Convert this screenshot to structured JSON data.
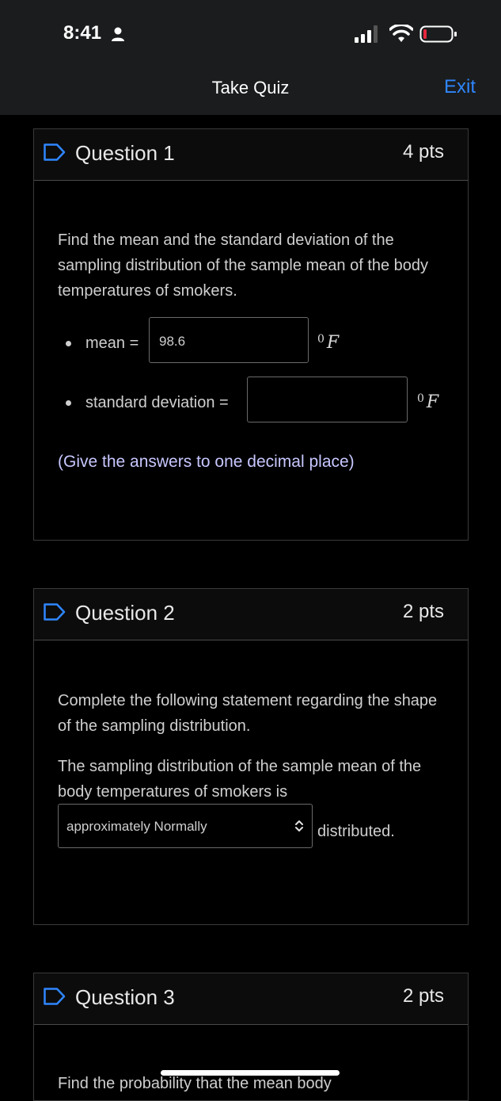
{
  "status_bar": {
    "time": "8:41",
    "icons": [
      "person-icon",
      "signal-icon",
      "wifi-icon",
      "battery-icon"
    ],
    "battery_color": "#e5263b"
  },
  "nav": {
    "title": "Take Quiz",
    "exit_label": "Exit",
    "accent_color": "#2f86ff"
  },
  "questions": [
    {
      "title": "Question 1",
      "points": "4 pts",
      "prompt": "Find the mean and the standard deviation of the sampling distribution of the sample mean of the body temperatures of smokers.",
      "fields": [
        {
          "label": "mean =",
          "value": "98.6",
          "unit": "F",
          "unit_sup": "0"
        },
        {
          "label": "standard deviation =",
          "value": "",
          "unit": "F",
          "unit_sup": "0"
        }
      ],
      "hint": "(Give the answers to one decimal place)"
    },
    {
      "title": "Question 2",
      "points": "2 pts",
      "prompt": "Complete the following statement regarding the shape of the sampling distribution.",
      "statement": "The sampling distribution of the sample mean of the body temperatures of smokers is",
      "select_value": "approximately Normally",
      "suffix": "distributed."
    },
    {
      "title": "Question 3",
      "points": "2 pts",
      "prompt_partial": "Find the probability that the mean body"
    }
  ]
}
